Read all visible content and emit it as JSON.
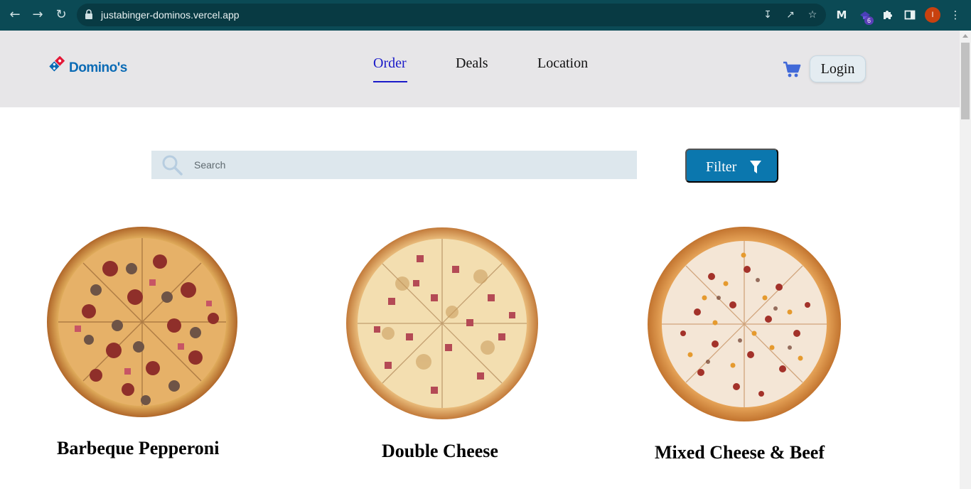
{
  "browser": {
    "url": "justabinger-dominos.vercel.app",
    "extension_badge": "6",
    "profile_initial": "I",
    "icons": [
      "back-icon",
      "forward-icon",
      "reload-icon",
      "lock-icon",
      "install-icon",
      "share-icon",
      "bookmark-star-icon",
      "extension-m-icon",
      "extension-hat-icon",
      "puzzle-icon",
      "side-panel-icon",
      "kebab-menu-icon"
    ]
  },
  "header": {
    "brand": "Domino's",
    "nav": [
      {
        "label": "Order",
        "active": true
      },
      {
        "label": "Deals",
        "active": false
      },
      {
        "label": "Location",
        "active": false
      }
    ],
    "login_label": "Login",
    "cart_icon": "cart-icon",
    "accent_color": "#1a1ac9"
  },
  "search": {
    "placeholder": "Search",
    "value": ""
  },
  "filter": {
    "label": "Filter",
    "icon": "funnel-icon",
    "color": "#0b77ae"
  },
  "products": [
    {
      "name": "Barbeque Pepperoni"
    },
    {
      "name": "Double Cheese"
    },
    {
      "name": "Mixed Cheese & Beef"
    }
  ]
}
